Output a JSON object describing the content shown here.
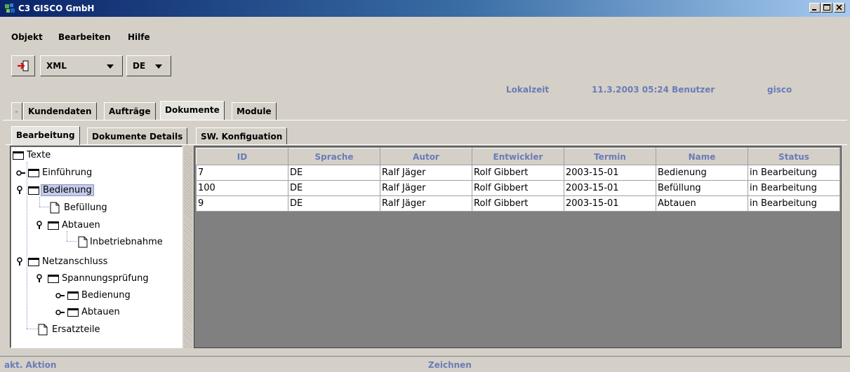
{
  "window": {
    "title": "C3 GISCO GmbH",
    "buttons": [
      "minimize",
      "maximize",
      "close"
    ]
  },
  "menu": [
    "Objekt",
    "Bearbeiten",
    "Hilfe"
  ],
  "toolbar": {
    "exit_icon": "exit-door-icon",
    "format_value": "XML",
    "language_value": "DE"
  },
  "info": {
    "localtime_label": "Lokalzeit",
    "datetime_user": "11.3.2003 05:24 Benutzer",
    "username": "gisco",
    "accent_color": "#6a7bb8"
  },
  "main_tabs": [
    "Kundendaten",
    "Aufträge",
    "Dokumente",
    "Module"
  ],
  "main_tab_active": "Dokumente",
  "sub_tabs": [
    "Bearbeitung",
    "Dokumente Details",
    "SW. Konfiguation"
  ],
  "sub_tab_active": "Bearbeitung",
  "tree": [
    {
      "label": "Texte",
      "type": "folder",
      "level": 0
    },
    {
      "label": "Einführung",
      "type": "folder",
      "level": 1,
      "handle": "collapsed"
    },
    {
      "label": "Bedienung",
      "type": "folder",
      "level": 1,
      "handle": "expanded",
      "selected": true
    },
    {
      "label": "Befüllung",
      "type": "document",
      "level": 2
    },
    {
      "label": "Abtauen",
      "type": "folder",
      "level": 2,
      "handle": "expanded"
    },
    {
      "label": "Inbetriebnahme",
      "type": "document",
      "level": 3
    },
    {
      "label": "Netzanschluss",
      "type": "folder",
      "level": 1,
      "handle": "expanded"
    },
    {
      "label": "Spannungsprüfung",
      "type": "folder",
      "level": 2,
      "handle": "expanded"
    },
    {
      "label": "Bedienung",
      "type": "folder",
      "level": 3,
      "handle": "collapsed"
    },
    {
      "label": "Abtauen",
      "type": "folder",
      "level": 3,
      "handle": "collapsed"
    },
    {
      "label": "Ersatzteile",
      "type": "document",
      "level": 1
    }
  ],
  "table": {
    "columns": [
      "ID",
      "Sprache",
      "Autor",
      "Entwickler",
      "Termin",
      "Name",
      "Status"
    ],
    "rows": [
      [
        "7",
        "DE",
        "Ralf Jäger",
        "Rolf Gibbert",
        "2003-15-01",
        "Bedienung",
        "in Bearbeitung"
      ],
      [
        "100",
        "DE",
        "Ralf Jäger",
        "Rolf Gibbert",
        "2003-15-01",
        "Befüllung",
        "in Bearbeitung"
      ],
      [
        "9",
        "DE",
        "Ralf Jäger",
        "Rolf Gibbert",
        "2003-15-01",
        "Abtauen",
        "in Bearbeitung"
      ]
    ]
  },
  "status": {
    "left": "akt. Aktion",
    "center": "Zeichnen"
  }
}
